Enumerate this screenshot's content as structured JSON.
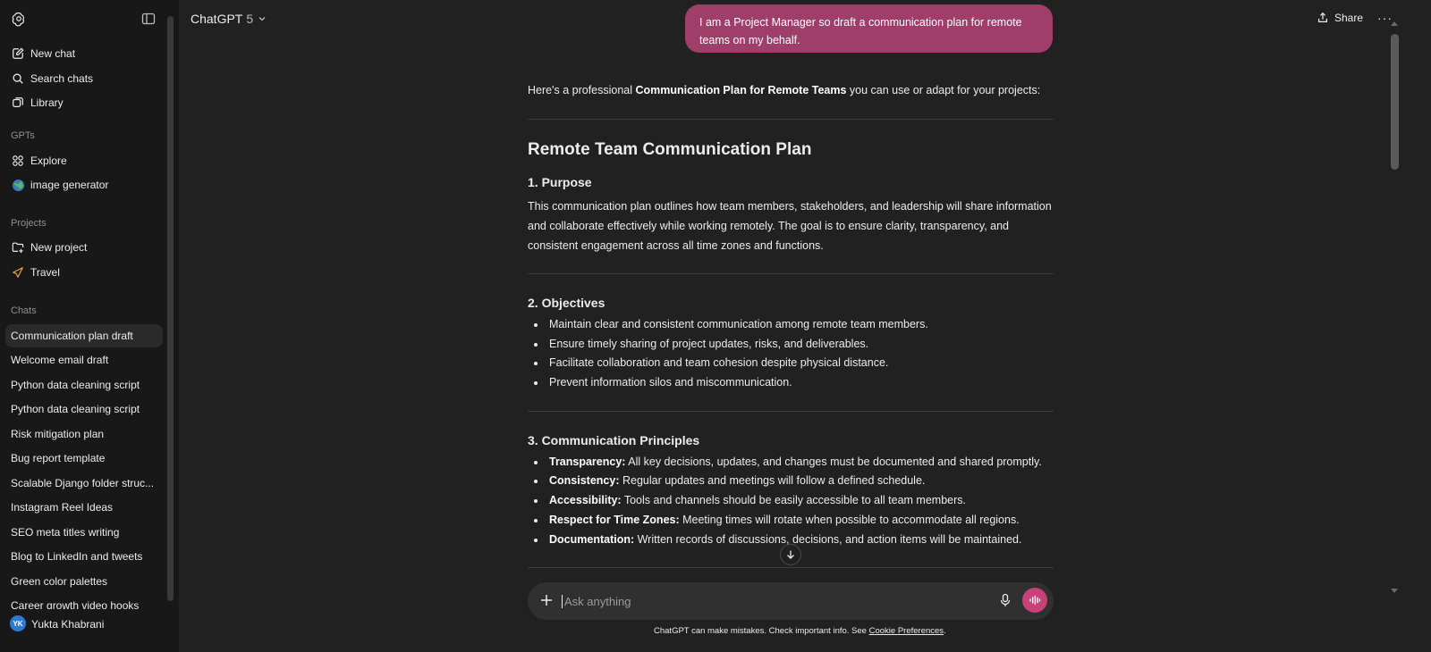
{
  "sidebar": {
    "top_items": [
      {
        "label": "New chat",
        "icon": "pencil-square-icon"
      },
      {
        "label": "Search chats",
        "icon": "search-icon"
      },
      {
        "label": "Library",
        "icon": "library-icon"
      }
    ],
    "gpts_label": "GPTs",
    "gpts": [
      {
        "label": "Explore",
        "icon": "grid-icon"
      },
      {
        "label": "image generator",
        "icon": "globe-icon"
      }
    ],
    "projects_label": "Projects",
    "projects": [
      {
        "label": "New project",
        "icon": "folder-plus-icon"
      },
      {
        "label": "Travel",
        "icon": "plane-icon"
      }
    ],
    "chats_label": "Chats",
    "chats": [
      "Communication plan draft",
      "Welcome email draft",
      "Python data cleaning script",
      "Python data cleaning script",
      "Risk mitigation plan",
      "Bug report template",
      "Scalable Django folder struc...",
      "Instagram Reel Ideas",
      "SEO meta titles writing",
      "Blog to LinkedIn and tweets",
      "Green color palettes",
      "Career growth video hooks"
    ],
    "user": {
      "initials": "YK",
      "name": "Yukta Khabrani"
    }
  },
  "header": {
    "model": "ChatGPT",
    "version": "5",
    "share": "Share",
    "more": "···"
  },
  "user_message": "I am a Project Manager so draft a communication plan for remote teams on my behalf.",
  "response": {
    "intro_pre": "Here's a professional ",
    "intro_bold": "Communication Plan for Remote Teams",
    "intro_post": " you can use or adapt for your projects:",
    "title": "Remote Team Communication Plan",
    "purpose_heading": "1. Purpose",
    "purpose_text": "This communication plan outlines how team members, stakeholders, and leadership will share information and collaborate effectively while working remotely. The goal is to ensure clarity, transparency, and consistent engagement across all time zones and functions.",
    "objectives_heading": "2. Objectives",
    "objectives": [
      "Maintain clear and consistent communication among remote team members.",
      "Ensure timely sharing of project updates, risks, and deliverables.",
      "Facilitate collaboration and team cohesion despite physical distance.",
      "Prevent information silos and miscommunication."
    ],
    "principles_heading": "3. Communication Principles",
    "principles": [
      {
        "term": "Transparency:",
        "text": " All key decisions, updates, and changes must be documented and shared promptly."
      },
      {
        "term": "Consistency:",
        "text": " Regular updates and meetings will follow a defined schedule."
      },
      {
        "term": "Accessibility:",
        "text": " Tools and channels should be easily accessible to all team members."
      },
      {
        "term": "Respect for Time Zones:",
        "text": " Meeting times will rotate when possible to accommodate all regions."
      },
      {
        "term": "Documentation:",
        "text": " Written records of discussions, decisions, and action items will be maintained."
      }
    ]
  },
  "composer": {
    "placeholder": "Ask anything"
  },
  "disclaimer": {
    "pre": "ChatGPT can make mistakes. Check important info. See ",
    "link": "Cookie Preferences",
    "post": "."
  },
  "colors": {
    "bubble": "#a03e6a",
    "voice_button": "#c8427a",
    "background": "#212121",
    "sidebar": "#181818"
  }
}
